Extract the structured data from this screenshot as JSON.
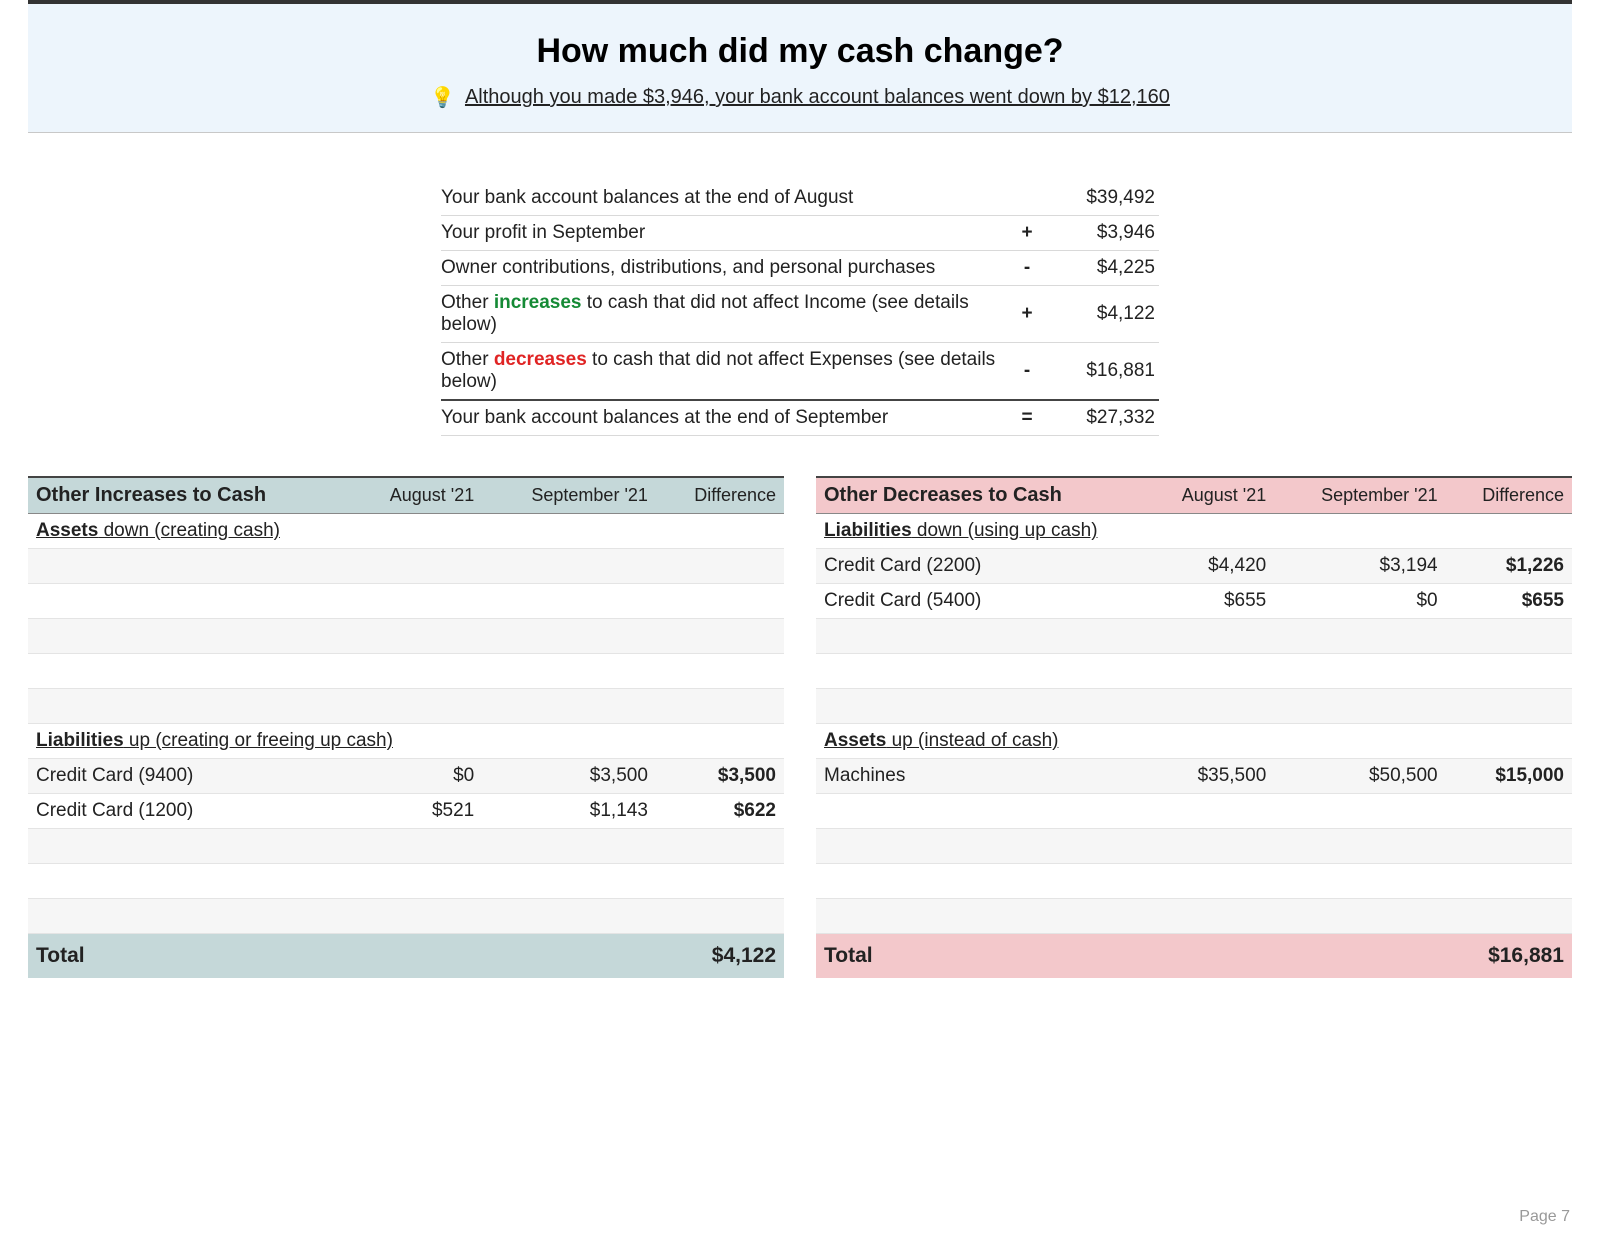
{
  "banner": {
    "title": "How much did my cash change?",
    "bulb": "💡",
    "callout": "Although you made $3,946, your bank account balances went down by $12,160"
  },
  "summary": {
    "r1": {
      "label": "Your bank account balances at the end of August",
      "op": "",
      "val": "$39,492"
    },
    "r2": {
      "label": "Your profit in September",
      "op": "+",
      "val": "$3,946"
    },
    "r3": {
      "label": "Owner contributions, distributions, and personal purchases",
      "op": "-",
      "val": "$4,225"
    },
    "r4": {
      "pre": "Other ",
      "word": "increases",
      "post": " to cash that did not affect Income (see details below)",
      "op": "+",
      "val": "$4,122"
    },
    "r5": {
      "pre": "Other ",
      "word": "decreases",
      "post": " to cash that did not affect Expenses (see details below)",
      "op": "-",
      "val": "$16,881"
    },
    "r6": {
      "label": "Your bank account balances at the end of September",
      "op": "=",
      "val": "$27,332"
    }
  },
  "cols": {
    "col1": "August '21",
    "col2": "September '21",
    "col3": "Difference"
  },
  "inc": {
    "title": "Other Increases to Cash",
    "s1a": "Assets",
    "s1b": " down (creating cash)",
    "s2a": "Liabilities",
    "s2b": " up (creating or freeing up cash)",
    "rows": {
      "cc94": {
        "label": "Credit Card (9400)",
        "c1": "$0",
        "c2": "$3,500",
        "c3": "$3,500"
      },
      "cc12": {
        "label": "Credit Card (1200)",
        "c1": "$521",
        "c2": "$1,143",
        "c3": "$622"
      }
    },
    "total_label": "Total",
    "total_val": "$4,122"
  },
  "dec": {
    "title": "Other Decreases to Cash",
    "s1a": "Liabilities",
    "s1b": " down (using up cash)",
    "s2a": "Assets",
    "s2b": " up (instead of cash)",
    "rows": {
      "cc22": {
        "label": "Credit Card (2200)",
        "c1": "$4,420",
        "c2": "$3,194",
        "c3": "$1,226"
      },
      "cc54": {
        "label": "Credit Card (5400)",
        "c1": "$655",
        "c2": "$0",
        "c3": "$655"
      },
      "mach": {
        "label": "Machines",
        "c1": "$35,500",
        "c2": "$50,500",
        "c3": "$15,000"
      }
    },
    "total_label": "Total",
    "total_val": "$16,881"
  },
  "footer": {
    "page": "Page 7"
  }
}
